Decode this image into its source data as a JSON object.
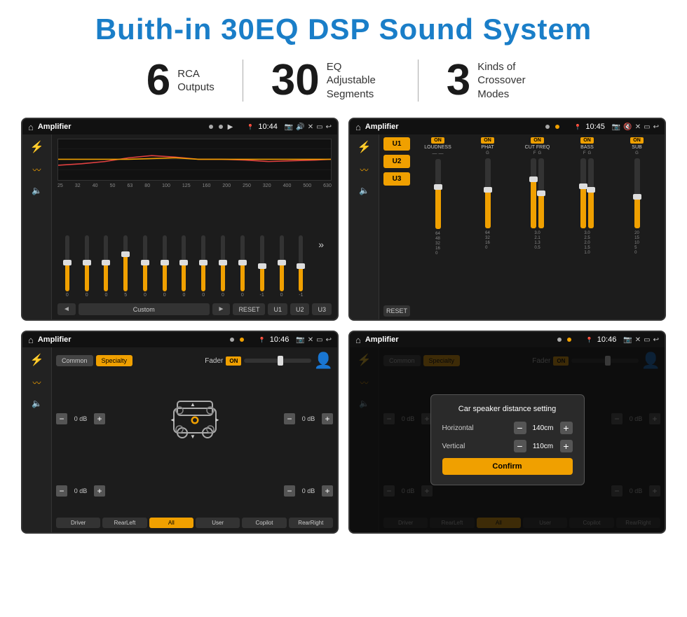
{
  "header": {
    "title": "Buith-in 30EQ DSP Sound System"
  },
  "stats": [
    {
      "number": "6",
      "label": "RCA\nOutputs"
    },
    {
      "number": "30",
      "label": "EQ Adjustable\nSegments"
    },
    {
      "number": "3",
      "label": "Kinds of\nCrossover Modes"
    }
  ],
  "screens": [
    {
      "id": "screen1",
      "statusBar": {
        "appName": "Amplifier",
        "time": "10:44"
      },
      "type": "eq"
    },
    {
      "id": "screen2",
      "statusBar": {
        "appName": "Amplifier",
        "time": "10:45"
      },
      "type": "crossover"
    },
    {
      "id": "screen3",
      "statusBar": {
        "appName": "Amplifier",
        "time": "10:46"
      },
      "type": "fader"
    },
    {
      "id": "screen4",
      "statusBar": {
        "appName": "Amplifier",
        "time": "10:46"
      },
      "type": "fader-dialog"
    }
  ],
  "eq": {
    "frequencies": [
      "25",
      "32",
      "40",
      "50",
      "63",
      "80",
      "100",
      "125",
      "160",
      "200",
      "250",
      "320",
      "400",
      "500",
      "630"
    ],
    "values": [
      "0",
      "0",
      "0",
      "5",
      "0",
      "0",
      "0",
      "0",
      "0",
      "0",
      "-1",
      "0",
      "-1"
    ],
    "buttons": [
      "◄",
      "Custom",
      "►",
      "RESET",
      "U1",
      "U2",
      "U3"
    ]
  },
  "crossover": {
    "units": [
      "U1",
      "U2",
      "U3"
    ],
    "channels": [
      {
        "toggle": "ON",
        "name": "LOUDNESS"
      },
      {
        "toggle": "ON",
        "name": "PHAT"
      },
      {
        "toggle": "ON",
        "name": "CUT FREQ"
      },
      {
        "toggle": "ON",
        "name": "BASS"
      },
      {
        "toggle": "ON",
        "name": "SUB"
      }
    ],
    "resetLabel": "RESET"
  },
  "fader": {
    "tabs": [
      "Common",
      "Specialty"
    ],
    "activeTab": "Specialty",
    "faderLabel": "Fader",
    "faderToggle": "ON",
    "dbValues": [
      "0 dB",
      "0 dB",
      "0 dB",
      "0 dB"
    ],
    "buttons": [
      "Driver",
      "RearLeft",
      "All",
      "User",
      "Copilot",
      "RearRight"
    ]
  },
  "dialog": {
    "title": "Car speaker distance setting",
    "horizontalLabel": "Horizontal",
    "horizontalValue": "140cm",
    "verticalLabel": "Vertical",
    "verticalValue": "110cm",
    "confirmLabel": "Confirm"
  },
  "colors": {
    "accent": "#f0a000",
    "blue": "#1a7ec8",
    "dark": "#1c1c1c",
    "text": "#ffffff"
  }
}
